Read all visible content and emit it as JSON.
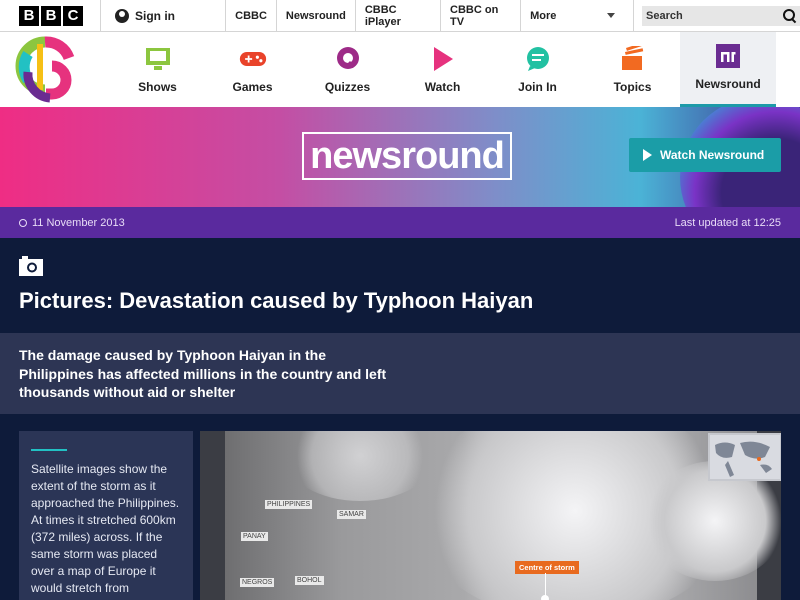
{
  "bbc_bar": {
    "logo_letters": [
      "B",
      "B",
      "C"
    ],
    "signin": "Sign in",
    "links": [
      "CBBC",
      "Newsround",
      "CBBC iPlayer",
      "CBBC on TV"
    ],
    "more": "More",
    "search_placeholder": "Search"
  },
  "cbbc_nav": {
    "items": [
      {
        "label": "Shows",
        "icon": "monitor-icon",
        "color": "#8cc63f"
      },
      {
        "label": "Games",
        "icon": "gamepad-icon",
        "color": "#e9432a"
      },
      {
        "label": "Quizzes",
        "icon": "quiz-icon",
        "color": "#9d2a87"
      },
      {
        "label": "Watch",
        "icon": "play-icon",
        "color": "#e6327e"
      },
      {
        "label": "Join In",
        "icon": "chat-icon",
        "color": "#22c1a2"
      },
      {
        "label": "Topics",
        "icon": "topics-icon",
        "color": "#f26a21"
      },
      {
        "label": "Newsround",
        "icon": "newsround-icon",
        "color": "#6a2c91"
      }
    ],
    "active": "Newsround"
  },
  "banner": {
    "logo_text": "newsround",
    "watch_button": "Watch Newsround"
  },
  "article": {
    "date": "11 November 2013",
    "updated": "Last updated at 12:25",
    "headline": "Pictures: Devastation caused by Typhoon Haiyan",
    "summary": "The damage caused by Typhoon Haiyan in the Philippines has affected millions in the country and left thousands without aid or shelter",
    "caption": "Satellite images show the extent of the storm as it approached the Philippines. At times it stretched 600km (372 miles) across. If the same storm was placed over a map of Europe it would stretch from"
  },
  "image": {
    "labels": [
      "PHILIPPINES",
      "SAMAR",
      "PANAY",
      "NEGROS",
      "BOHOL"
    ],
    "storm_label": "Centre of storm"
  },
  "colors": {
    "accent": "#1b9da7",
    "date_bar": "#5a2a9e",
    "page_bg": "#0e1b3a"
  }
}
